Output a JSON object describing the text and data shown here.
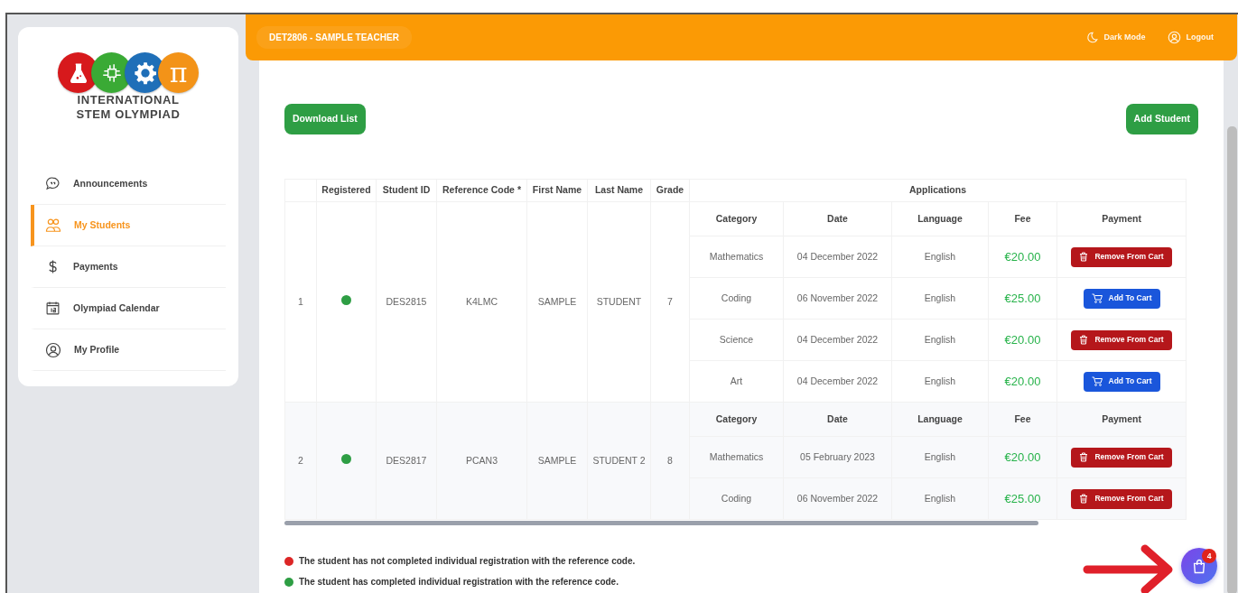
{
  "sidebar": {
    "logo": {
      "symbol": "π",
      "lines": [
        "INTERNATIONAL",
        "STEM OLYMPIAD"
      ]
    },
    "items": [
      {
        "label": "Announcements",
        "selected": false
      },
      {
        "label": "My Students",
        "selected": true
      },
      {
        "label": "Payments",
        "selected": false
      },
      {
        "label": "Olympiad Calendar",
        "selected": false
      },
      {
        "label": "My Profile",
        "selected": false
      }
    ]
  },
  "header": {
    "user": "DET2806 - SAMPLE TEACHER",
    "actions": [
      "Dark Mode",
      "Logout"
    ]
  },
  "toolbar": {
    "buttons": [
      "Download List",
      "Add Student"
    ]
  },
  "table": {
    "columns": [
      "Registered",
      "Student ID",
      "Reference Code *",
      "First Name",
      "Last Name",
      "Grade"
    ],
    "group_heading": "Applications",
    "rows": [
      {
        "application_columns": [
          "Category",
          "Date",
          "Language",
          "Fee",
          "Payment"
        ],
        "number": "1",
        "registered": true,
        "student_id": "DES2815",
        "reference_code": "K4LMC",
        "first_name": "SAMPLE",
        "last_name": "STUDENT",
        "grade": "7",
        "applications": [
          {
            "category": "Mathematics",
            "date": "04 December 2022",
            "language": "English",
            "fee": "€20.00",
            "payment": {
              "kind": "remove",
              "label": "Remove From Cart"
            }
          },
          {
            "category": "Coding",
            "date": "06 November 2022",
            "language": "English",
            "fee": "€25.00",
            "payment": {
              "kind": "add",
              "label": "Add To Cart"
            }
          },
          {
            "category": "Science",
            "date": "04 December 2022",
            "language": "English",
            "fee": "€20.00",
            "payment": {
              "kind": "remove",
              "label": "Remove From Cart"
            }
          },
          {
            "category": "Art",
            "date": "04 December 2022",
            "language": "English",
            "fee": "€20.00",
            "payment": {
              "kind": "add",
              "label": "Add To Cart"
            }
          }
        ]
      },
      {
        "application_columns": [
          "Category",
          "Date",
          "Language",
          "Fee",
          "Payment"
        ],
        "number": "2",
        "registered": true,
        "student_id": "DES2817",
        "reference_code": "PCAN3",
        "first_name": "SAMPLE",
        "last_name": "STUDENT 2",
        "grade": "8",
        "applications": [
          {
            "category": "Mathematics",
            "date": "05 February 2023",
            "language": "English",
            "fee": "€20.00",
            "payment": {
              "kind": "remove",
              "label": "Remove From Cart"
            }
          },
          {
            "category": "Coding",
            "date": "06 November 2022",
            "language": "English",
            "fee": "€25.00",
            "payment": {
              "kind": "remove",
              "label": "Remove From Cart"
            }
          }
        ]
      }
    ]
  },
  "legend": [
    {
      "color": "#dc2626",
      "text": "The student has not completed individual registration with the reference code."
    },
    {
      "color": "#2e9e44",
      "text": "The student has completed individual registration with the reference code."
    }
  ],
  "cart": {
    "count": "4"
  }
}
